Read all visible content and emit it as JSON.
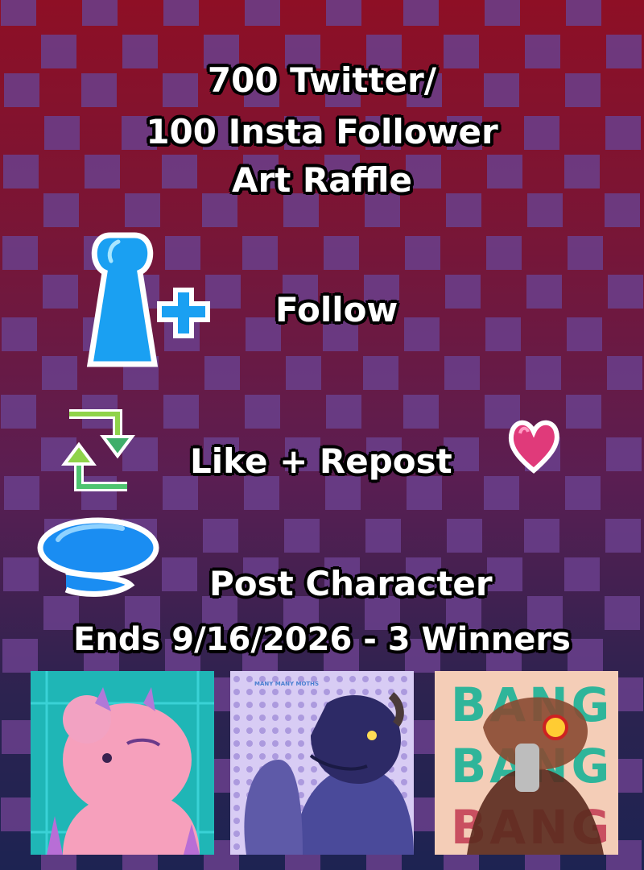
{
  "title": {
    "line1": "700 Twitter/",
    "line2": "100 Insta Follower",
    "line3": "Art Raffle"
  },
  "steps": {
    "follow": "Follow",
    "like_repost": "Like + Repost",
    "post_character": "Post Character"
  },
  "ends": "Ends 9/16/2026 - 3 Winners",
  "thumbnails": {
    "middle_watermark": "MANY MANY MOTHS",
    "right_text": "BANG BANG BANG"
  },
  "colors": {
    "checker": "#6a3f8c",
    "follow_icon": "#1aa0f2",
    "heart": "#e03a7a",
    "arrows_green": "#7ad04a"
  },
  "icons": [
    "follow-person-icon",
    "repost-arrows-icon",
    "heart-icon",
    "speech-bubble-icon"
  ]
}
